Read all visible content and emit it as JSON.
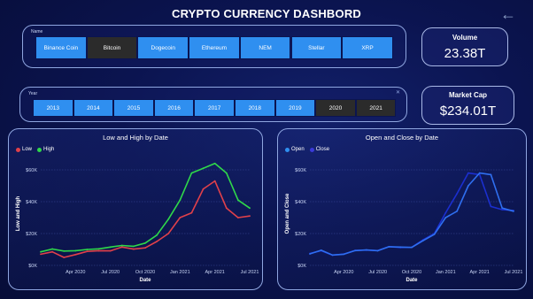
{
  "header": {
    "title": "CRYPTO CURRENCY DASHBORD"
  },
  "name_slicer": {
    "label": "Name",
    "options": [
      "Binance Coin",
      "Bitcoin",
      "Dogecoin",
      "Ethereum",
      "NEM",
      "Stellar",
      "XRP"
    ],
    "selected": "Bitcoin"
  },
  "year_slicer": {
    "label": "Year",
    "options": [
      "2013",
      "2014",
      "2015",
      "2016",
      "2017",
      "2018",
      "2019",
      "2020",
      "2021"
    ],
    "selected": [
      "2020",
      "2021"
    ]
  },
  "kpis": {
    "volume": {
      "label": "Volume",
      "value": "23.38T"
    },
    "market_cap": {
      "label": "Market Cap",
      "value": "$234.01T"
    }
  },
  "colors": {
    "low": "#e0404a",
    "high": "#2fd84a",
    "open": "#2f8ff0",
    "close": "#1b2fd0",
    "button": "#2f8ff0",
    "button_selected": "#2b2b2b"
  },
  "chart_data": [
    {
      "type": "line",
      "title": "Low and High by Date",
      "xlabel": "Date",
      "ylabel": "Low and High",
      "x_ticks": [
        "Apr 2020",
        "Jul 2020",
        "Oct 2020",
        "Jan 2021",
        "Apr 2021",
        "Jul 2021"
      ],
      "y_ticks": [
        "$0K",
        "$20K",
        "$40K",
        "$60K"
      ],
      "ylim": [
        0,
        65000
      ],
      "x": [
        "2020-01",
        "2020-02",
        "2020-03",
        "2020-04",
        "2020-05",
        "2020-06",
        "2020-07",
        "2020-08",
        "2020-09",
        "2020-10",
        "2020-11",
        "2020-12",
        "2021-01",
        "2021-02",
        "2021-03",
        "2021-04",
        "2021-05",
        "2021-06",
        "2021-07"
      ],
      "series": [
        {
          "name": "Low",
          "values": [
            7000,
            8500,
            5000,
            6800,
            8800,
            9200,
            9100,
            11500,
            10200,
            11000,
            15000,
            20000,
            30000,
            33000,
            48000,
            53000,
            36000,
            30000,
            31000
          ]
        },
        {
          "name": "High",
          "values": [
            8500,
            10300,
            9000,
            9200,
            10000,
            10400,
            11500,
            12500,
            12000,
            14000,
            19000,
            29000,
            41000,
            58000,
            61000,
            64000,
            58000,
            41000,
            36000
          ]
        }
      ],
      "grid": true,
      "legend": "top-left"
    },
    {
      "type": "line",
      "title": "Open and Close by Date",
      "xlabel": "Date",
      "ylabel": "Open and Close",
      "x_ticks": [
        "Apr 2020",
        "Jul 2020",
        "Oct 2020",
        "Jan 2021",
        "Apr 2021",
        "Jul 2021"
      ],
      "y_ticks": [
        "$0K",
        "$20K",
        "$40K",
        "$60K"
      ],
      "ylim": [
        0,
        65000
      ],
      "x": [
        "2020-01",
        "2020-02",
        "2020-03",
        "2020-04",
        "2020-05",
        "2020-06",
        "2020-07",
        "2020-08",
        "2020-09",
        "2020-10",
        "2020-11",
        "2020-12",
        "2021-01",
        "2021-02",
        "2021-03",
        "2021-04",
        "2021-05",
        "2021-06",
        "2021-07"
      ],
      "series": [
        {
          "name": "Open",
          "values": [
            7200,
            9500,
            6500,
            7000,
            9300,
            9700,
            9200,
            11700,
            11500,
            11300,
            15500,
            19500,
            30000,
            34000,
            50000,
            58000,
            57000,
            36000,
            34000
          ]
        },
        {
          "name": "Close",
          "values": [
            7500,
            9200,
            6400,
            7100,
            9400,
            9600,
            9300,
            11800,
            11200,
            11400,
            16000,
            20000,
            33000,
            45000,
            58000,
            57000,
            37000,
            35000,
            34500
          ]
        }
      ],
      "grid": true,
      "legend": "top-left"
    }
  ]
}
